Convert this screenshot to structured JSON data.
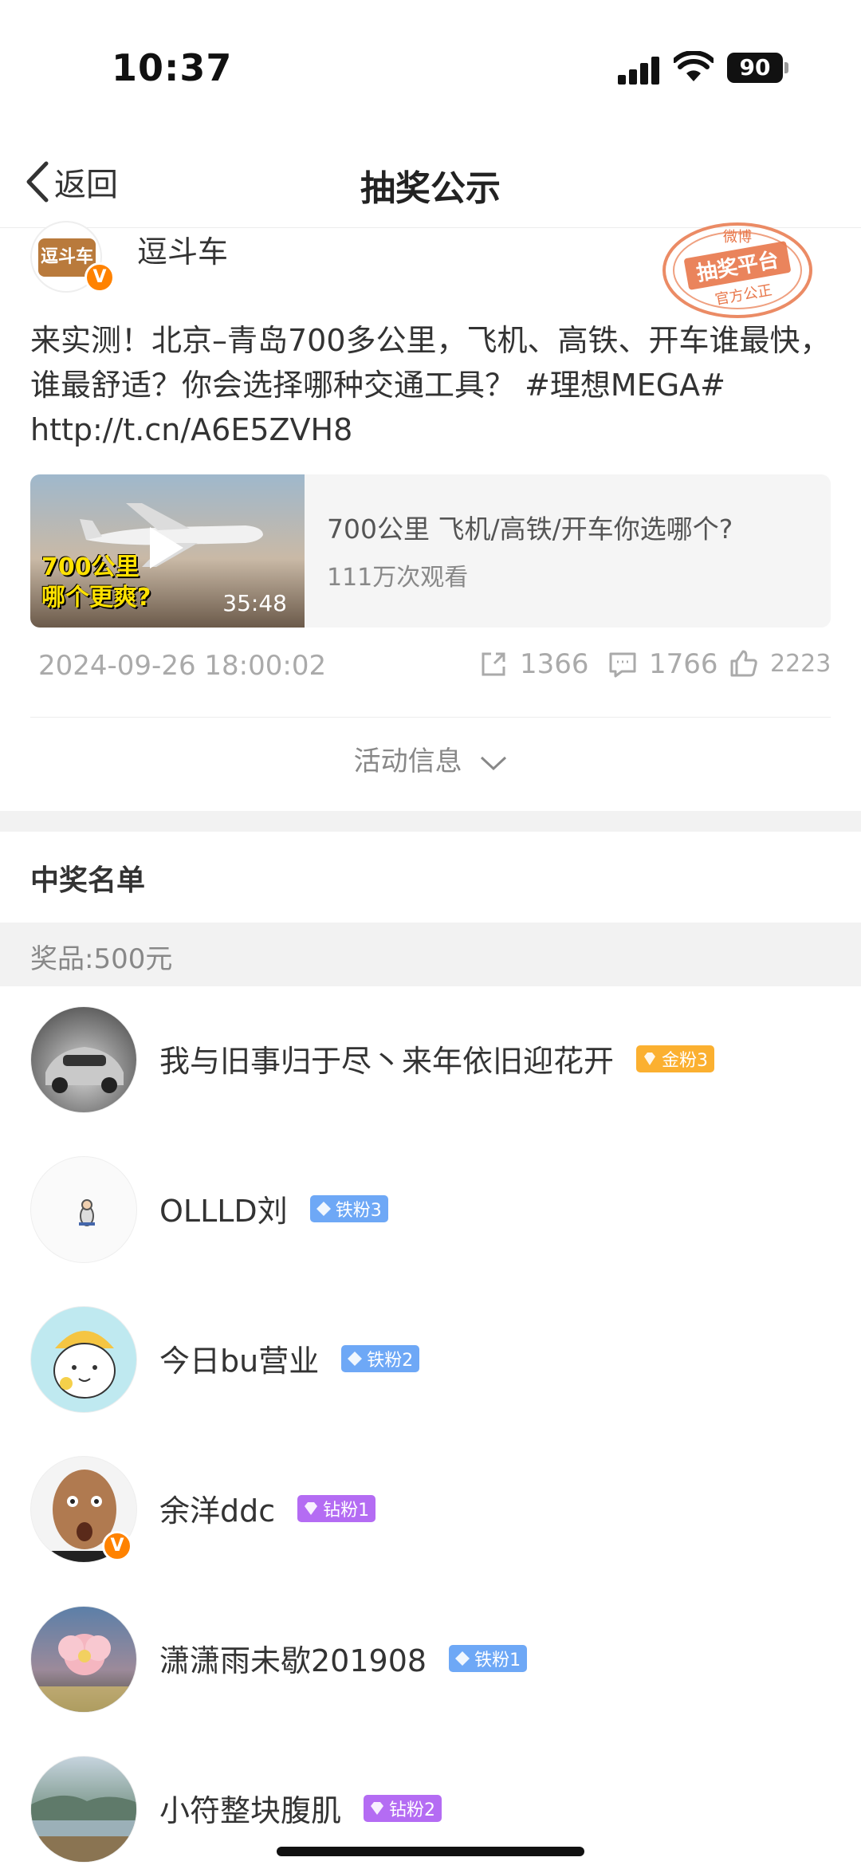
{
  "status_bar": {
    "time": "10:37",
    "battery": "90"
  },
  "nav": {
    "back_label": "返回",
    "title": "抽奖公示"
  },
  "post": {
    "author": "逗斗车",
    "author_logo_text": "逗斗车",
    "stamp": {
      "top": "微博",
      "middle": "抽奖平台",
      "bottom": "官方公正"
    },
    "text": "来实测！北京–青岛700多公里，飞机、高铁、开车谁最快，谁最舒适？你会选择哪种交通工具？ #理想MEGA# http://t.cn/A6E5ZVH8",
    "video": {
      "thumb_text_line1": "700公里",
      "thumb_text_line2": "哪个更爽?",
      "duration": "35:48",
      "title": "700公里 飞机/高铁/开车你选哪个?",
      "views": "111万次观看"
    },
    "timestamp": "2024-09-26 18:00:02",
    "shares": "1366",
    "comments": "1766",
    "likes": "2223",
    "activity_info_label": "活动信息"
  },
  "winners": {
    "title": "中奖名单",
    "prize": "奖品:500元",
    "list": [
      {
        "name": "我与旧事归于尽丶来年依旧迎花开",
        "badge": "金粉3",
        "badge_type": "gold"
      },
      {
        "name": "OLLLD刘",
        "badge": "铁粉3",
        "badge_type": "iron"
      },
      {
        "name": "今日bu营业",
        "badge": "铁粉2",
        "badge_type": "iron"
      },
      {
        "name": "余洋ddc",
        "badge": "钻粉1",
        "badge_type": "diamond"
      },
      {
        "name": "潇潇雨未歇201908",
        "badge": "铁粉1",
        "badge_type": "iron"
      },
      {
        "name": "小符整块腹肌",
        "badge": "钻粉2",
        "badge_type": "diamond"
      }
    ]
  },
  "colors": {
    "accent_orange": "#ff8200",
    "badge_gold": "#fbb030",
    "badge_iron": "#6ea8f6",
    "badge_diamond": "#b46cf3"
  }
}
